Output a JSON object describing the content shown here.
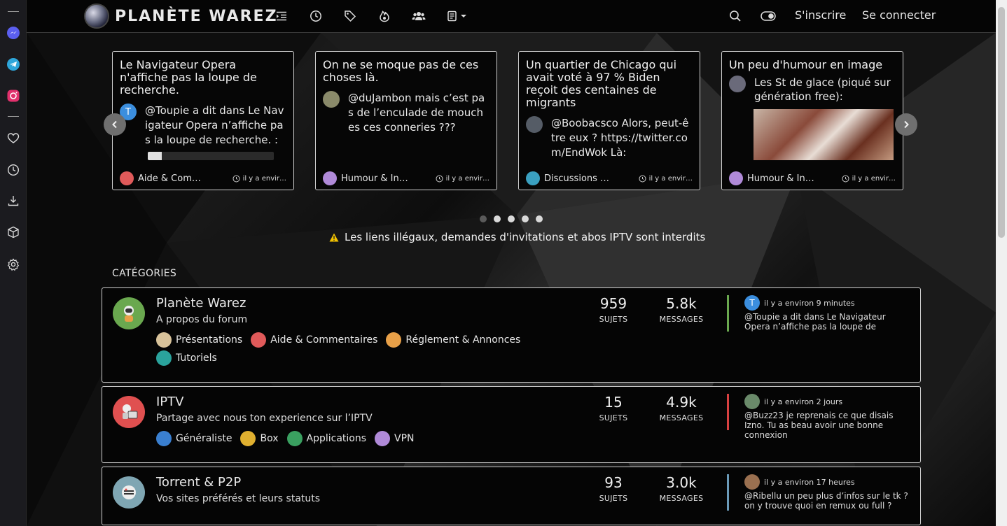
{
  "header": {
    "logo_text": "PLANÈTE WAREZ",
    "register": "S'inscrire",
    "login": "Se connecter"
  },
  "carousel": {
    "cards": [
      {
        "title": "Le Navigateur Opera n'affiche pas la loupe de recherche.",
        "avatar_letter": "T",
        "avatar_color": "#3b8ede",
        "text": "@Toupie a dit dans Le Navigateur Opera n’affiche pas la loupe de recherche. :",
        "category": "Aide & Com…",
        "time": "il y a envir…"
      },
      {
        "title": "On ne se moque pas de ces choses là.",
        "avatar_color": "#8a8a6a",
        "text": "@duJambon mais c’est pas de l’enculade de mouches ces conneries ???",
        "category": "Humour & In…",
        "time": "il y a envir…"
      },
      {
        "title": "Un quartier de Chicago qui avait voté à 97 % Biden reçoit des centaines de migrants",
        "avatar_color": "#555c66",
        "text": "@Boobacsco Alors, peut-être eux ? https://twitter.com/EndWok Là:",
        "category": "Discussions …",
        "time": "il y a envir…"
      },
      {
        "title": "Un peu d'humour en image",
        "avatar_color": "#6a6a7a",
        "text": "Les St de glace (piqué sur génération free):",
        "category": "Humour & In…",
        "time": "il y a envir…"
      }
    ],
    "dots": 5,
    "active_dot": 0
  },
  "warning": "Les liens illégaux, demandes d'invitations et abos IPTV sont interdits",
  "categories_heading": "CATÉGORIES",
  "categories": [
    {
      "name": "Planète Warez",
      "description": "A propos du forum",
      "icon_color": "#6aa84f",
      "subcategories": [
        {
          "label": "Présentations",
          "color": "#d8c29a"
        },
        {
          "label": "Aide & Commentaires",
          "color": "#e05a5a"
        },
        {
          "label": "Réglement & Annonces",
          "color": "#e8a048"
        },
        {
          "label": "Tutoriels",
          "color": "#2aa39c"
        }
      ],
      "topics": "959",
      "topics_label": "SUJETS",
      "posts": "5.8k",
      "posts_label": "MESSAGES",
      "accent": "#6aa84f",
      "last_avatar_letter": "T",
      "last_avatar_color": "#3b8ede",
      "last_time": "il y a environ 9 minutes",
      "last_text": "@Toupie a dit dans Le Navigateur Opera n’affiche pas la loupe de"
    },
    {
      "name": "IPTV",
      "description": "Partage avec nous ton experience sur l’IPTV",
      "icon_color": "#e05050",
      "subcategories": [
        {
          "label": "Généraliste",
          "color": "#3a7fd0"
        },
        {
          "label": "Box",
          "color": "#e0b030"
        },
        {
          "label": "Applications",
          "color": "#3aa060"
        },
        {
          "label": "VPN",
          "color": "#b08ad8"
        }
      ],
      "topics": "15",
      "topics_label": "SUJETS",
      "posts": "4.9k",
      "posts_label": "MESSAGES",
      "accent": "#d84040",
      "last_avatar_color": "#6a8a6a",
      "last_time": "il y a environ 2 jours",
      "last_text": "@Buzz23 je reprenais ce que disais Izno. Tu as beau avoir une bonne connexion"
    },
    {
      "name": "Torrent & P2P",
      "description": "Vos sites préférés et leurs statuts",
      "icon_color": "#7fa6b3",
      "subcategories": [],
      "topics": "93",
      "topics_label": "SUJETS",
      "posts": "3.0k",
      "posts_label": "MESSAGES",
      "accent": "#6a9ab8",
      "last_avatar_color": "#9a7050",
      "last_time": "il y a environ 17 heures",
      "last_text": "@Ribellu un peu plus d’infos sur le tk ? on y trouve quoi en remux ou full ?"
    }
  ],
  "colors": {
    "messenger": "#5b5ff0",
    "telegram": "#2ea6da",
    "instagram": "#e1306c",
    "warning_icon": "#f2c200"
  }
}
